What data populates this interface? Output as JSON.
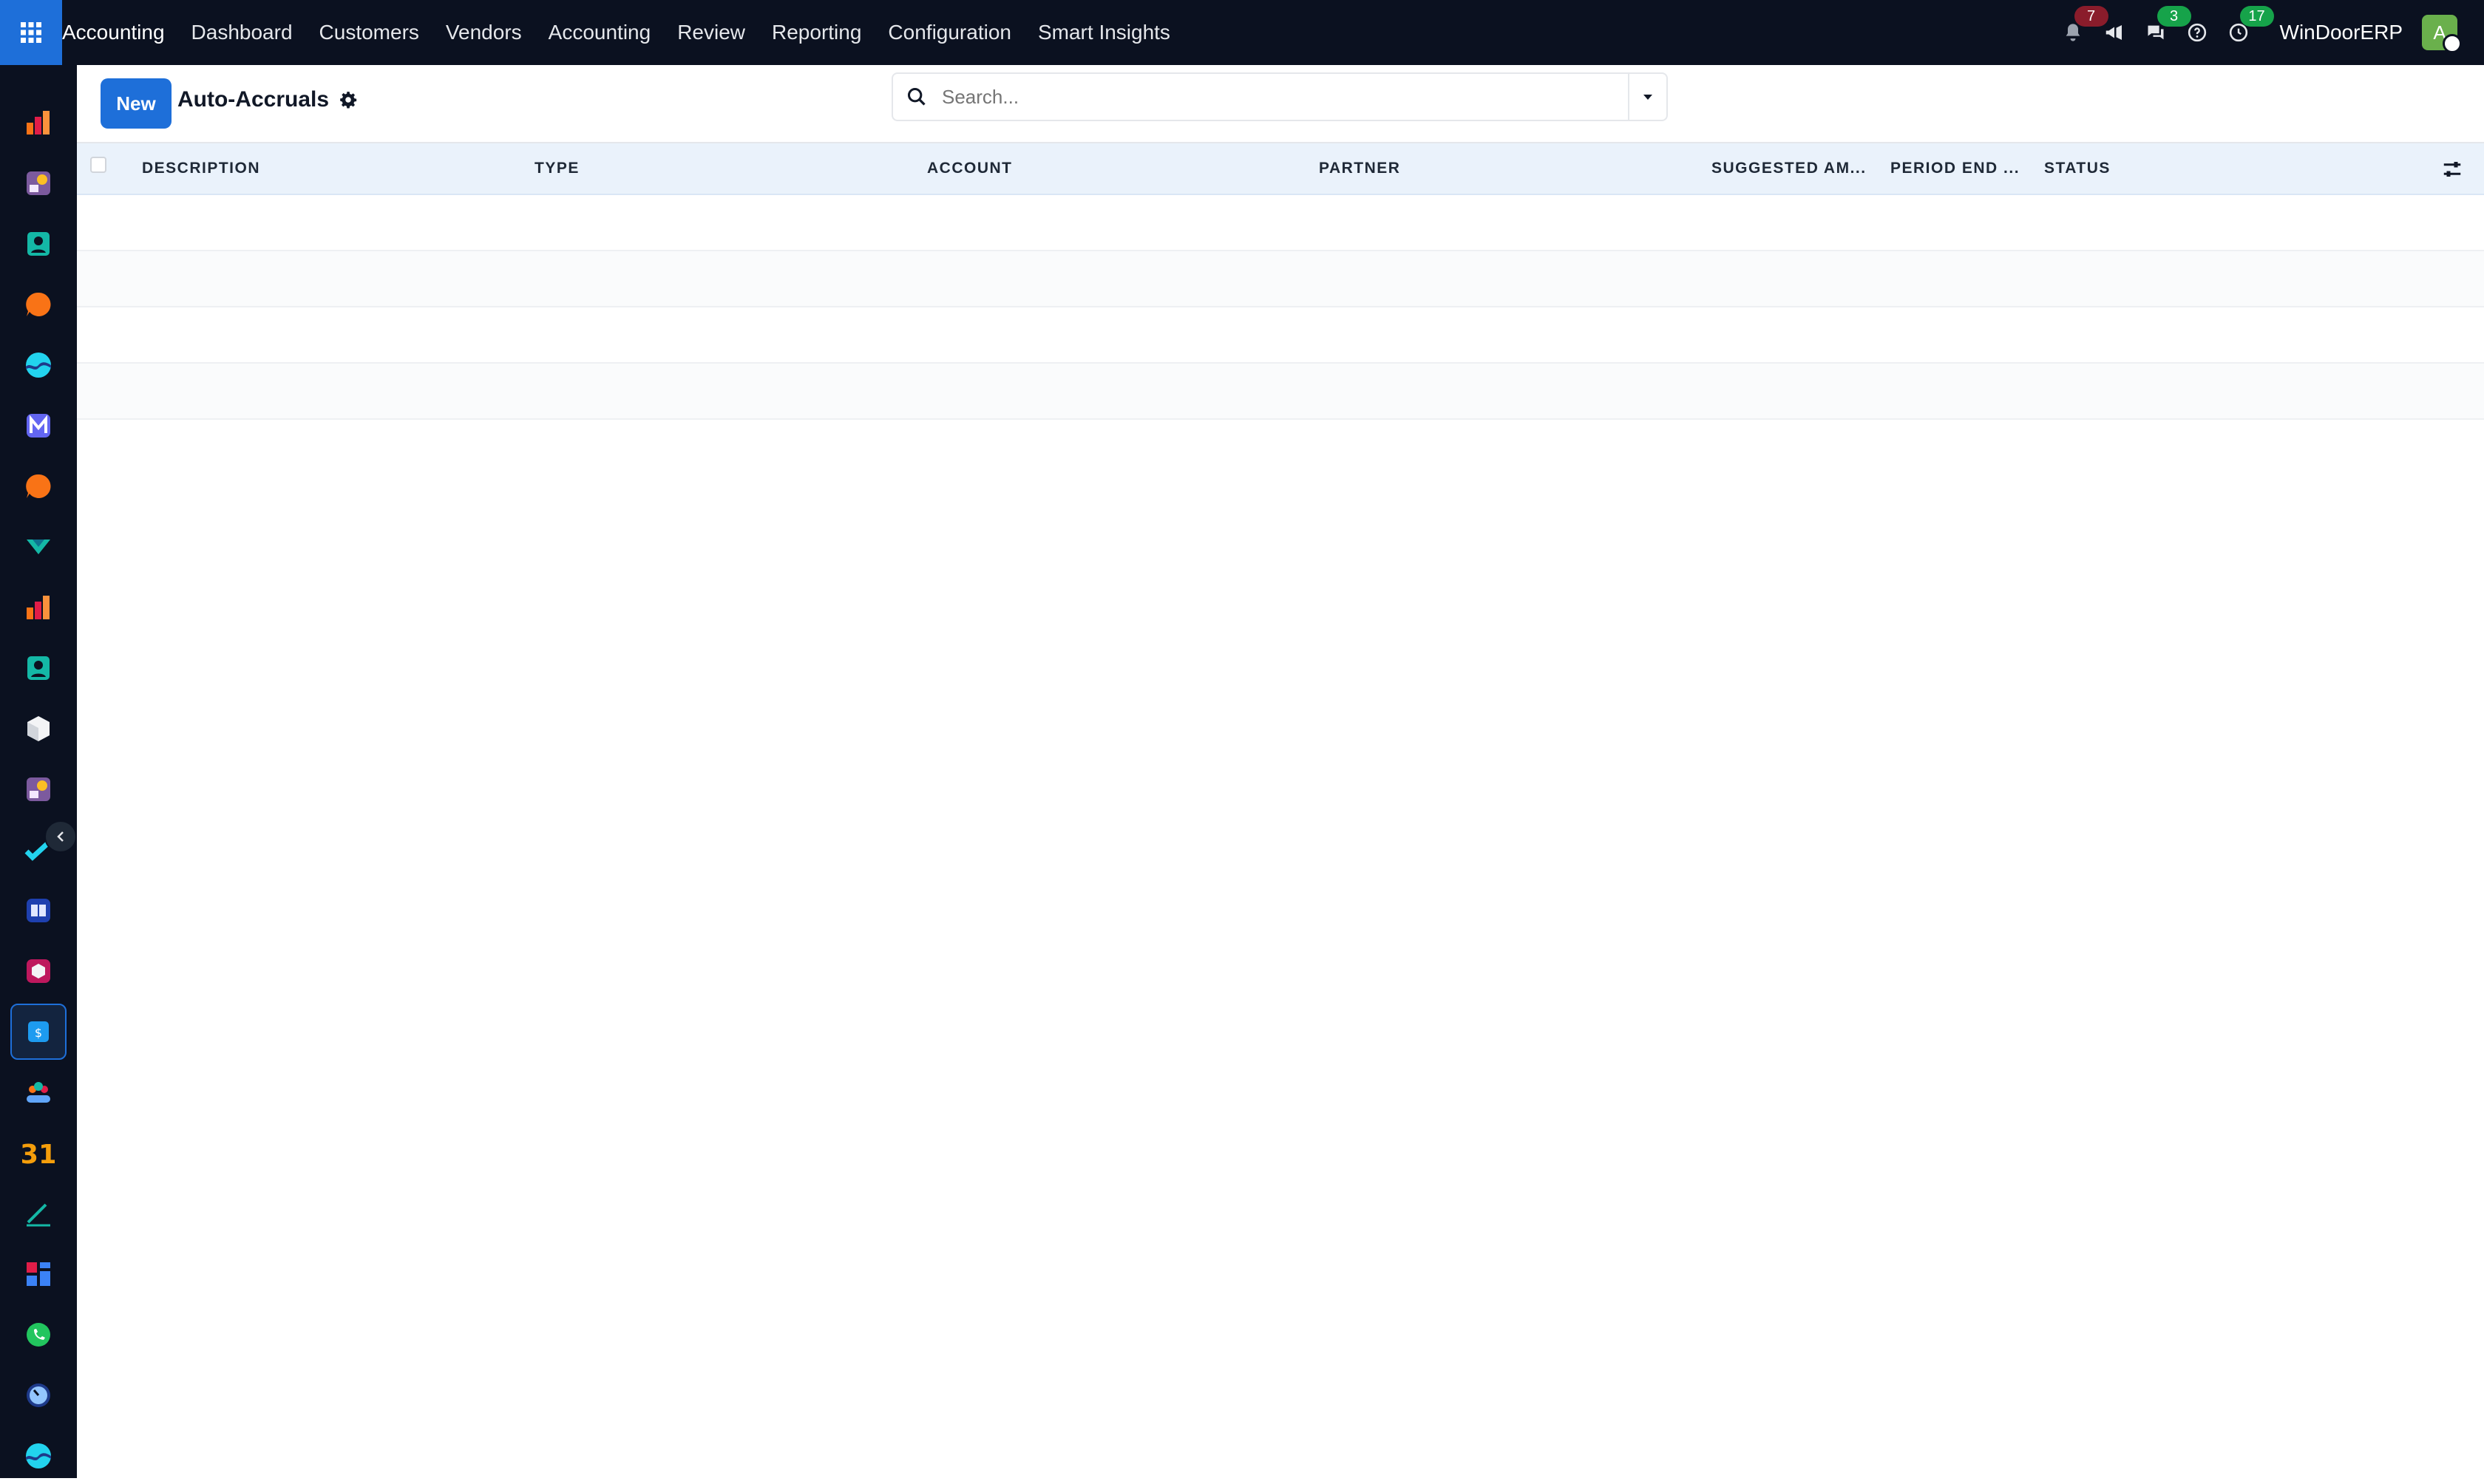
{
  "topbar": {
    "app_name": "Accounting",
    "menu": [
      "Dashboard",
      "Customers",
      "Vendors",
      "Accounting",
      "Review",
      "Reporting",
      "Configuration",
      "Smart Insights"
    ],
    "notifications_badge": "7",
    "messages_badge": "3",
    "activities_badge": "17",
    "company": "WinDoorERP",
    "avatar_initial": "A"
  },
  "control_panel": {
    "new_label": "New",
    "title": "Auto-Accruals",
    "search_placeholder": "Search..."
  },
  "table": {
    "columns": [
      "DESCRIPTION",
      "TYPE",
      "ACCOUNT",
      "PARTNER",
      "SUGGESTED AM...",
      "PERIOD END ...",
      "STATUS"
    ],
    "rows": []
  },
  "colors": {
    "topbar_bg": "#0b1120",
    "accent": "#1e6fd9",
    "header_bg": "#eaf2fb"
  },
  "rail_icons": [
    "bar-chart-icon",
    "paint-icon",
    "contacts-icon",
    "chat-bubble-icon",
    "wave-icon",
    "mail-icon",
    "chat-bubble-icon",
    "chevron-icon",
    "bar-chart-icon",
    "contacts-icon",
    "cube-icon",
    "paint-icon",
    "check-icon",
    "book-icon",
    "box-icon",
    "invoice-icon",
    "team-icon",
    "calendar-icon",
    "sign-icon",
    "dashboard-icon",
    "whatsapp-icon",
    "gauge-icon",
    "wave-icon"
  ]
}
